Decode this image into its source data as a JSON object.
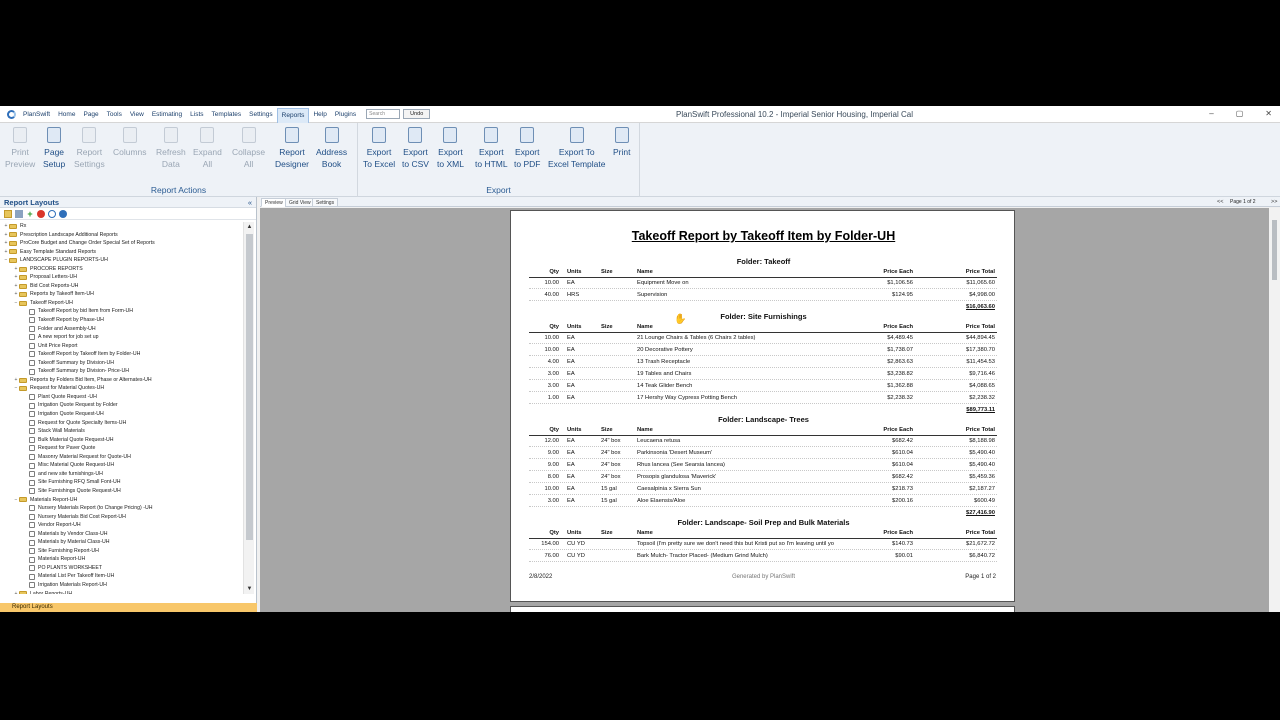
{
  "menubar": {
    "items": [
      "PlanSwift",
      "Home",
      "Page",
      "Tools",
      "View",
      "Estimating",
      "Lists",
      "Templates",
      "Settings",
      "Reports",
      "Help",
      "Plugins"
    ],
    "active": "Reports",
    "search_placeholder": "Search",
    "undo_label": "Undo",
    "window_title": "PlanSwift Professional 10.2 - Imperial Senior Housing, Imperial Cal",
    "controls": [
      "–",
      "▢",
      "✕"
    ]
  },
  "ribbon": {
    "report_actions": {
      "label": "Report Actions",
      "buttons": [
        {
          "l1": "Print",
          "l2": "Preview",
          "enabled": false,
          "icon": "print-preview-icon"
        },
        {
          "l1": "Page",
          "l2": "Setup",
          "enabled": true,
          "icon": "page-setup-icon"
        },
        {
          "l1": "Report",
          "l2": "Settings",
          "enabled": false,
          "icon": "report-settings-icon"
        },
        {
          "l1": "Columns",
          "l2": "",
          "enabled": false,
          "icon": "columns-icon"
        },
        {
          "l1": "Refresh",
          "l2": "Data",
          "enabled": false,
          "icon": "refresh-icon"
        },
        {
          "l1": "Expand",
          "l2": "All",
          "enabled": false,
          "icon": "expand-icon"
        },
        {
          "l1": "Collapse",
          "l2": "All",
          "enabled": false,
          "icon": "collapse-icon"
        },
        {
          "l1": "Report",
          "l2": "Designer",
          "enabled": true,
          "icon": "report-designer-icon"
        },
        {
          "l1": "Address",
          "l2": "Book",
          "enabled": true,
          "icon": "address-book-icon"
        }
      ]
    },
    "export": {
      "label": "Export",
      "buttons": [
        {
          "l1": "Export",
          "l2": "To Excel",
          "icon": "excel-icon"
        },
        {
          "l1": "Export",
          "l2": "to CSV",
          "icon": "csv-icon"
        },
        {
          "l1": "Export",
          "l2": "to XML",
          "icon": "xml-icon"
        },
        {
          "l1": "Export",
          "l2": "to HTML",
          "icon": "html-icon"
        },
        {
          "l1": "Export",
          "l2": "to PDF",
          "icon": "pdf-icon"
        },
        {
          "l1": "Export To",
          "l2": "Excel Template",
          "icon": "excel-template-icon"
        },
        {
          "l1": "Print",
          "l2": "",
          "icon": "printer-icon"
        }
      ]
    }
  },
  "left_panel": {
    "title": "Report Layouts",
    "collapse": "«",
    "footer": "Report Layouts",
    "tree": [
      {
        "level": 0,
        "type": "folder",
        "toggle": "+",
        "label": "Rx"
      },
      {
        "level": 0,
        "type": "folder",
        "toggle": "+",
        "label": "Prescription Landscape Additional Reports"
      },
      {
        "level": 0,
        "type": "folder",
        "toggle": "+",
        "label": "ProCore Budget and Change Order Special Set of Reports"
      },
      {
        "level": 0,
        "type": "folder",
        "toggle": "+",
        "label": "Easy Template Standard Reports"
      },
      {
        "level": 0,
        "type": "folder",
        "toggle": "−",
        "label": "LANDSCAPE PLUGIN REPORTS-UH"
      },
      {
        "level": 1,
        "type": "folder",
        "toggle": "+",
        "label": "PROCORE REPORTS"
      },
      {
        "level": 1,
        "type": "folder",
        "toggle": "+",
        "label": "Proposal Letters-UH"
      },
      {
        "level": 1,
        "type": "folder",
        "toggle": "+",
        "label": "Bid Cost Reports-UH"
      },
      {
        "level": 1,
        "type": "folder",
        "toggle": "+",
        "label": "Reports by Takeoff Item-UH"
      },
      {
        "level": 1,
        "type": "folder",
        "toggle": "−",
        "label": "Takeoff Report-UH"
      },
      {
        "level": 2,
        "type": "doc",
        "toggle": "",
        "label": "Takeoff Report by bid Item from Form-UH"
      },
      {
        "level": 2,
        "type": "doc",
        "toggle": "",
        "label": "Takeoff Report by Phase-UH"
      },
      {
        "level": 2,
        "type": "doc",
        "toggle": "",
        "label": "Folder and Assembly-UH"
      },
      {
        "level": 2,
        "type": "doc",
        "toggle": "",
        "label": "A new report for job set up"
      },
      {
        "level": 2,
        "type": "doc",
        "toggle": "",
        "label": "Unit Price Report"
      },
      {
        "level": 2,
        "type": "doc",
        "toggle": "",
        "label": "Takeoff Report by Takeoff Item by Folder-UH"
      },
      {
        "level": 2,
        "type": "doc",
        "toggle": "",
        "label": "Takeoff Summary by Division-UH"
      },
      {
        "level": 2,
        "type": "doc",
        "toggle": "",
        "label": "Takeoff Summary by Division- Price-UH"
      },
      {
        "level": 1,
        "type": "folder",
        "toggle": "+",
        "label": "Reports by Folders Bid Item, Phase or Alternates-UH"
      },
      {
        "level": 1,
        "type": "folder",
        "toggle": "−",
        "label": "Request for Material Quotes-UH"
      },
      {
        "level": 2,
        "type": "doc",
        "toggle": "",
        "label": "Plant Quote Request -UH"
      },
      {
        "level": 2,
        "type": "doc",
        "toggle": "",
        "label": "Irrigation Quote Request by Folder"
      },
      {
        "level": 2,
        "type": "doc",
        "toggle": "",
        "label": "Irrigation Quote Request-UH"
      },
      {
        "level": 2,
        "type": "doc",
        "toggle": "",
        "label": "Request for Quote Specialty Items-UH"
      },
      {
        "level": 2,
        "type": "doc",
        "toggle": "",
        "label": "Stack Wall Materials"
      },
      {
        "level": 2,
        "type": "doc",
        "toggle": "",
        "label": "Bulk Material Quote Request-UH"
      },
      {
        "level": 2,
        "type": "doc",
        "toggle": "",
        "label": "Request for Paver Quote"
      },
      {
        "level": 2,
        "type": "doc",
        "toggle": "",
        "label": "Masonry Material Request for Quote-UH"
      },
      {
        "level": 2,
        "type": "doc",
        "toggle": "",
        "label": "Misc Material Quote Request-UH"
      },
      {
        "level": 2,
        "type": "doc",
        "toggle": "",
        "label": "and new site furnishings-UH"
      },
      {
        "level": 2,
        "type": "doc",
        "toggle": "",
        "label": "Site Furnishing RFQ Small Font-UH"
      },
      {
        "level": 2,
        "type": "doc",
        "toggle": "",
        "label": "Site Furnishings Quote Request-UH"
      },
      {
        "level": 1,
        "type": "folder",
        "toggle": "−",
        "label": "Materials Report-UH"
      },
      {
        "level": 2,
        "type": "doc",
        "toggle": "",
        "label": "Nursery Materials Report (to Change Pricing) -UH"
      },
      {
        "level": 2,
        "type": "doc",
        "toggle": "",
        "label": "Nursery Materials Bid Cost Report-UH"
      },
      {
        "level": 2,
        "type": "doc",
        "toggle": "",
        "label": "Vendor Report-UH"
      },
      {
        "level": 2,
        "type": "doc",
        "toggle": "",
        "label": "Materials by Vendor Class-UH"
      },
      {
        "level": 2,
        "type": "doc",
        "toggle": "",
        "label": "Materials by Material Class-UH"
      },
      {
        "level": 2,
        "type": "doc",
        "toggle": "",
        "label": "Site Furnishing Report-UH"
      },
      {
        "level": 2,
        "type": "doc",
        "toggle": "",
        "label": "Materials Report-UH"
      },
      {
        "level": 2,
        "type": "doc",
        "toggle": "",
        "label": "PO PLANTS WORKSHEET"
      },
      {
        "level": 2,
        "type": "doc",
        "toggle": "",
        "label": "Material List Per Takeoff Item-UH"
      },
      {
        "level": 2,
        "type": "doc",
        "toggle": "",
        "label": "Irrigation Materials Report-UH"
      },
      {
        "level": 1,
        "type": "folder",
        "toggle": "+",
        "label": "Labor Reports-UH"
      }
    ]
  },
  "preview_tabs": [
    "Preview",
    "Grid View",
    "Settings"
  ],
  "pager": {
    "prev": "<<",
    "page": "Page 1 of 2",
    "next": ">>"
  },
  "report": {
    "title": "Takeoff Report by Takeoff Item by Folder-UH",
    "columns": {
      "qty": "Qty",
      "units": "Units",
      "size": "Size",
      "name": "Name",
      "price": "Price Each",
      "total": "Price Total"
    },
    "folders": [
      {
        "name": "Folder: Takeoff",
        "rows": [
          {
            "qty": "10.00",
            "units": "EA",
            "size": "",
            "name": "Equipment Move on",
            "price": "$1,106.56",
            "total": "$11,065.60"
          },
          {
            "qty": "40.00",
            "units": "HRS",
            "size": "",
            "name": "Supervision",
            "price": "$124.95",
            "total": "$4,998.00"
          }
        ],
        "subtotal": "$16,063.60"
      },
      {
        "name": "Folder: Site Furnishings",
        "rows": [
          {
            "qty": "10.00",
            "units": "EA",
            "size": "",
            "name": "21 Lounge Chairs & Tables (6 Chairs 2 tables)",
            "price": "$4,489.45",
            "total": "$44,894.45"
          },
          {
            "qty": "10.00",
            "units": "EA",
            "size": "",
            "name": "20 Decorative Pottery",
            "price": "$1,738.07",
            "total": "$17,380.70"
          },
          {
            "qty": "4.00",
            "units": "EA",
            "size": "",
            "name": "13 Trash Receptacle",
            "price": "$2,863.63",
            "total": "$11,454.53"
          },
          {
            "qty": "3.00",
            "units": "EA",
            "size": "",
            "name": "19 Tables and Chairs",
            "price": "$3,238.82",
            "total": "$9,716.46"
          },
          {
            "qty": "3.00",
            "units": "EA",
            "size": "",
            "name": "14 Teak Glider Bench",
            "price": "$1,362.88",
            "total": "$4,088.65"
          },
          {
            "qty": "1.00",
            "units": "EA",
            "size": "",
            "name": "17 Hershy Way Cypress Potting Bench",
            "price": "$2,238.32",
            "total": "$2,238.32"
          }
        ],
        "subtotal": "$89,773.11"
      },
      {
        "name": "Folder: Landscape- Trees",
        "rows": [
          {
            "qty": "12.00",
            "units": "EA",
            "size": "24\" box",
            "name": "Leucaena retusa",
            "price": "$682.42",
            "total": "$8,188.98"
          },
          {
            "qty": "9.00",
            "units": "EA",
            "size": "24\" box",
            "name": "Parkinsonia 'Desert Museum'",
            "price": "$610.04",
            "total": "$5,490.40"
          },
          {
            "qty": "9.00",
            "units": "EA",
            "size": "24\" box",
            "name": "Rhus lancea (See Searsia lancea)",
            "price": "$610.04",
            "total": "$5,490.40"
          },
          {
            "qty": "8.00",
            "units": "EA",
            "size": "24\" box",
            "name": "Prosopis glandulosa 'Maverick'",
            "price": "$682.42",
            "total": "$5,459.36"
          },
          {
            "qty": "10.00",
            "units": "EA",
            "size": "15 gal",
            "name": "Caesalpinia x Sierra Sun",
            "price": "$218.73",
            "total": "$2,187.27"
          },
          {
            "qty": "3.00",
            "units": "EA",
            "size": "15 gal",
            "name": "Aloe Elaensis/Aloe",
            "price": "$200.16",
            "total": "$600.49"
          }
        ],
        "subtotal": "$27,416.90"
      },
      {
        "name": "Folder: Landscape- Soil Prep and Bulk Materials",
        "rows": [
          {
            "qty": "154.00",
            "units": "CU YD",
            "size": "",
            "name": "Topsoil (I'm pretty sure we don't need this but Kristi put so I'm leaving until yo",
            "price": "$140.73",
            "total": "$21,672.72"
          },
          {
            "qty": "76.00",
            "units": "CU YD",
            "size": "",
            "name": "Bark Mulch- Tractor Placed- (Medium Grind Mulch)",
            "price": "$90.01",
            "total": "$6,840.72"
          }
        ],
        "subtotal": ""
      }
    ],
    "footer": {
      "date": "2/8/2022",
      "generated": "Generated by PlanSwift",
      "page": "Page 1 of 2"
    }
  },
  "colors": {
    "accent": "#1f4e86",
    "footer_bar": "#f8c76a",
    "preview_bg": "#a6a6a6"
  }
}
